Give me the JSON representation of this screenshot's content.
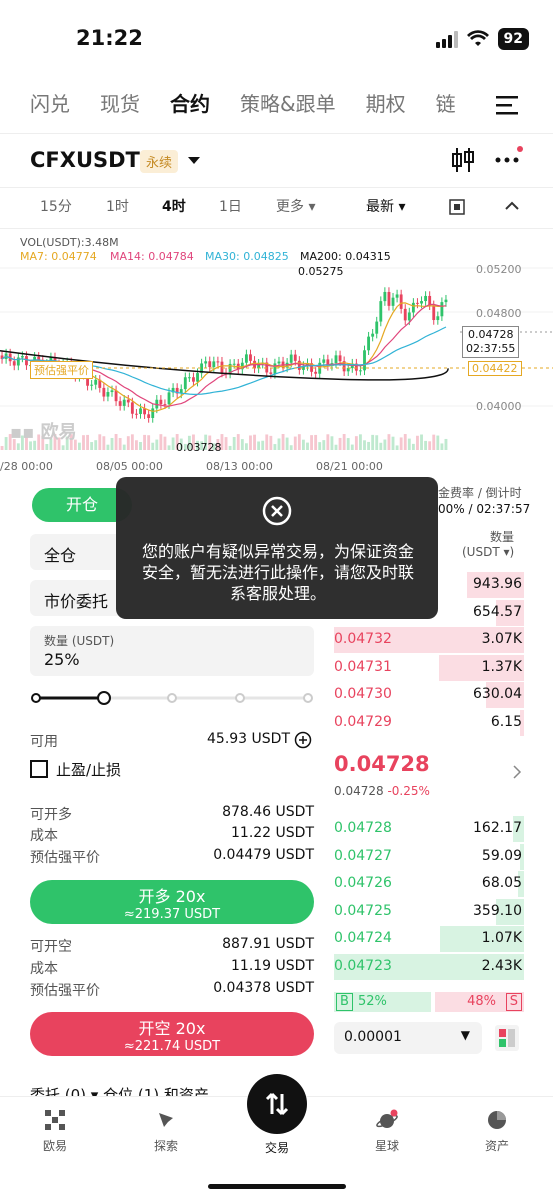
{
  "status_bar": {
    "time": "21:22",
    "battery": "92"
  },
  "top_tabs": [
    "闪兑",
    "现货",
    "合约",
    "策略&跟单",
    "期权",
    "链"
  ],
  "active_tab": "合约",
  "header": {
    "pair": "CFXUSDT",
    "badge": "永续"
  },
  "timeframes": [
    "15分",
    "1时",
    "4时",
    "1日",
    "更多",
    "最新"
  ],
  "active_timeframe": "4时",
  "chart": {
    "vol_label": "VOL(USDT):3.48M",
    "ma7": "MA7: 0.04774",
    "ma14": "MA14: 0.04784",
    "ma30": "MA30: 0.04825",
    "ma200": "MA200: 0.04315",
    "high_label": "0.05275",
    "low_label": "0.03728",
    "liq_label": "预估强平价",
    "price_tag": "0.04728",
    "countdown": "02:37:55",
    "liq_price_tag": "0.04422",
    "y_ticks": [
      "0.05200",
      "0.04800",
      "0.04000"
    ],
    "x_ticks": [
      "/28 00:00",
      "08/05 00:00",
      "08/13 00:00",
      "08/21 00:00"
    ],
    "watermark": "欧易",
    "colors": {
      "up": "#2fc36a",
      "down": "#e8435e",
      "ma7": "#e5a823",
      "ma14": "#e0467c",
      "ma30": "#31b3d6",
      "ma200": "#111111"
    }
  },
  "order_form": {
    "open_tab": "开仓",
    "margin_mode": "全仓",
    "order_type": "市价委托",
    "qty_label": "数量 (USDT)",
    "qty_value": "25%",
    "slider_fraction": 0.25,
    "available_label": "可用",
    "available_value": "45.93 USDT",
    "tpsl_label": "止盈/止损",
    "long": {
      "max_label": "可开多",
      "max_value": "878.46 USDT",
      "cost_label": "成本",
      "cost_value": "11.22 USDT",
      "liq_label": "预估强平价",
      "liq_value": "0.04479 USDT",
      "button": "开多 20x",
      "button_sub": "≈219.37 USDT"
    },
    "short": {
      "max_label": "可开空",
      "max_value": "887.91 USDT",
      "cost_label": "成本",
      "cost_value": "11.19 USDT",
      "liq_label": "预估强平价",
      "liq_value": "0.04378 USDT",
      "button": "开空 20x",
      "button_sub": "≈221.74 USDT"
    }
  },
  "order_book": {
    "funding_label": "金费率 / 倒计时",
    "funding_value": "00% / 02:37:57",
    "qty_header": "数量",
    "qty_unit": "(USDT ▾)",
    "asks": [
      {
        "price": "",
        "qty": "943.96",
        "depth": 0.3
      },
      {
        "price": "",
        "qty": "654.57",
        "depth": 0.15
      },
      {
        "price": "0.04732",
        "qty": "3.07K",
        "depth": 1.0
      },
      {
        "price": "0.04731",
        "qty": "1.37K",
        "depth": 0.45
      },
      {
        "price": "0.04730",
        "qty": "630.04",
        "depth": 0.2
      },
      {
        "price": "0.04729",
        "qty": "6.15",
        "depth": 0.02
      }
    ],
    "last_price": "0.04728",
    "mark_price": "0.04728",
    "change": "-0.25%",
    "bids": [
      {
        "price": "0.04728",
        "qty": "162.17",
        "depth": 0.06
      },
      {
        "price": "0.04727",
        "qty": "59.09",
        "depth": 0.02
      },
      {
        "price": "0.04726",
        "qty": "68.05",
        "depth": 0.03
      },
      {
        "price": "0.04725",
        "qty": "359.10",
        "depth": 0.15
      },
      {
        "price": "0.04724",
        "qty": "1.07K",
        "depth": 0.44
      },
      {
        "price": "0.04723",
        "qty": "2.43K",
        "depth": 1.0
      }
    ],
    "buy_label": "B",
    "buy_pct": "52%",
    "sell_label": "S",
    "sell_pct": "48%",
    "precision": "0.00001"
  },
  "positions_tabs": "委托 (0) ▾   仓位 (1)   和资产",
  "toast": {
    "message": "您的账户有疑似异常交易，为保证资金安全，暂无法进行此操作，请您及时联系客服处理。"
  },
  "bottom_nav": [
    "欧易",
    "探索",
    "交易",
    "星球",
    "资产"
  ]
}
